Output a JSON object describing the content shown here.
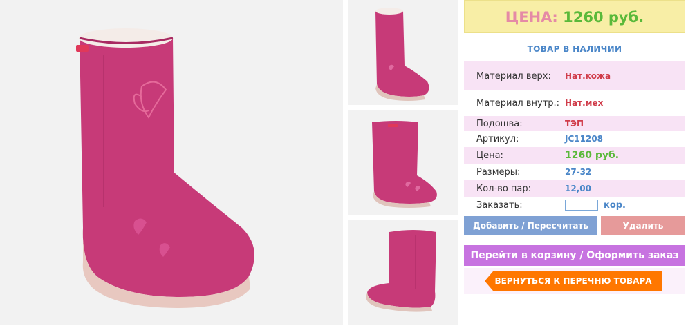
{
  "product": {
    "price_label": "ЦЕНА:",
    "price_value": "1260 руб.",
    "stock_status": "ТОВАР В НАЛИЧИИ"
  },
  "specs": [
    {
      "label": "Материал верх:",
      "value": "Нат.кожа"
    },
    {
      "label": "Материал внутр.:",
      "value": "Нат.мех"
    },
    {
      "label": "Подошва:",
      "value": "ТЭП"
    },
    {
      "label": "Артикул:",
      "value": "JC11208"
    },
    {
      "label": "Цена:",
      "value": "1260 руб."
    },
    {
      "label": "Размеры:",
      "value": "27-32"
    },
    {
      "label": "Кол-во пар:",
      "value": "12,00"
    }
  ],
  "order": {
    "label": "Заказать:",
    "input_value": "",
    "unit": "кор."
  },
  "buttons": {
    "add": "Добавить / Пересчитать",
    "delete": "Удалить",
    "cart": "Перейти в корзину / Оформить заказ",
    "back": "ВЕРНУТЬСЯ К ПЕРЕЧНЮ ТОВАРА"
  },
  "colors": {
    "boot": "#c73a78",
    "price_box": "#f8eea6",
    "accent_green": "#5ab93a",
    "accent_blue": "#4a86c8",
    "back_button": "#ff7700"
  },
  "icons": [
    "boot-main-image",
    "boot-thumbnail-1",
    "boot-thumbnail-2",
    "boot-thumbnail-3"
  ]
}
